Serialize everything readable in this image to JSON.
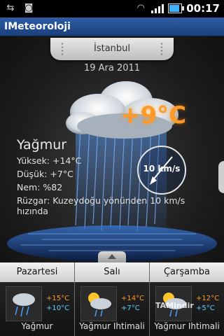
{
  "statusbar": {
    "time": "00:17"
  },
  "app": {
    "title": "IMeteoroloji"
  },
  "location": {
    "city": "İstanbul",
    "date": "19 Ara 2011"
  },
  "current": {
    "temperature": "+9°C",
    "condition": "Yağmur",
    "high": "Yüksek: +14°C",
    "low": "Düşük: +7°C",
    "humidity": "Nem: %82",
    "wind_text": "Rüzgar: Kuzeydoğu yönünden 10 km/s hızında",
    "wind_speed": "10 km/s"
  },
  "forecast": [
    {
      "day": "Pazartesi",
      "high": "+15°C",
      "low": "+10°C",
      "desc": "Yağmur",
      "icon": "rain-icon"
    },
    {
      "day": "Salı",
      "high": "+14°C",
      "low": "+7°C",
      "desc": "Yağmur Ihtimali",
      "icon": "sun-rain-icon"
    },
    {
      "day": "Çarşamba",
      "high": "+12°C",
      "low": "+5°C",
      "desc": "Yağmur Ihtimali",
      "icon": "sun-rain-icon"
    }
  ],
  "watermark": "TAMindir"
}
